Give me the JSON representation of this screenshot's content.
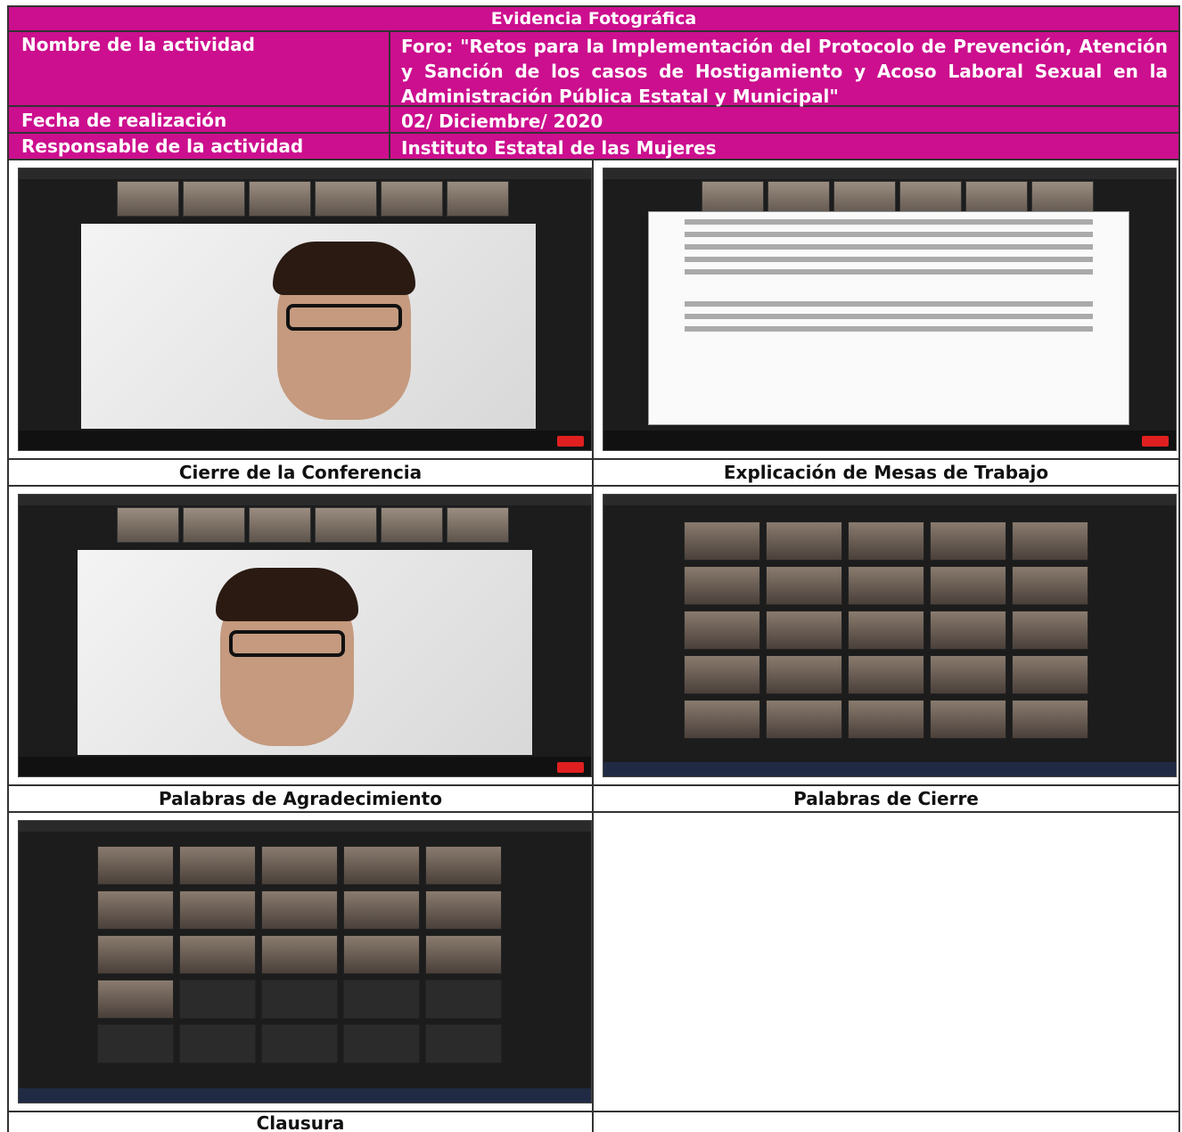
{
  "header": {
    "title": "Evidencia Fotográfica",
    "rows": [
      {
        "label": "Nombre de la actividad",
        "value": "Foro: \"Retos para la Implementación del Protocolo de Prevención, Atención y Sanción de los casos de Hostigamiento y Acoso Laboral Sexual en la Administración Pública Estatal y Municipal\""
      },
      {
        "label": "Fecha de realización",
        "value": "02/ Diciembre/ 2020"
      },
      {
        "label": "Responsable de la actividad",
        "value": "Instituto Estatal de las Mujeres"
      }
    ]
  },
  "photos": [
    {
      "caption": "Cierre de la Conferencia"
    },
    {
      "caption": "Explicación de Mesas de Trabajo"
    },
    {
      "caption": "Palabras de Agradecimiento"
    },
    {
      "caption": "Palabras de Cierre"
    },
    {
      "caption": "Clausura"
    }
  ],
  "colors": {
    "header_bg": "#cc0f8e",
    "header_text": "#ffffff",
    "zoom_bg": "#1c1c1c",
    "end_button": "#e02020"
  }
}
